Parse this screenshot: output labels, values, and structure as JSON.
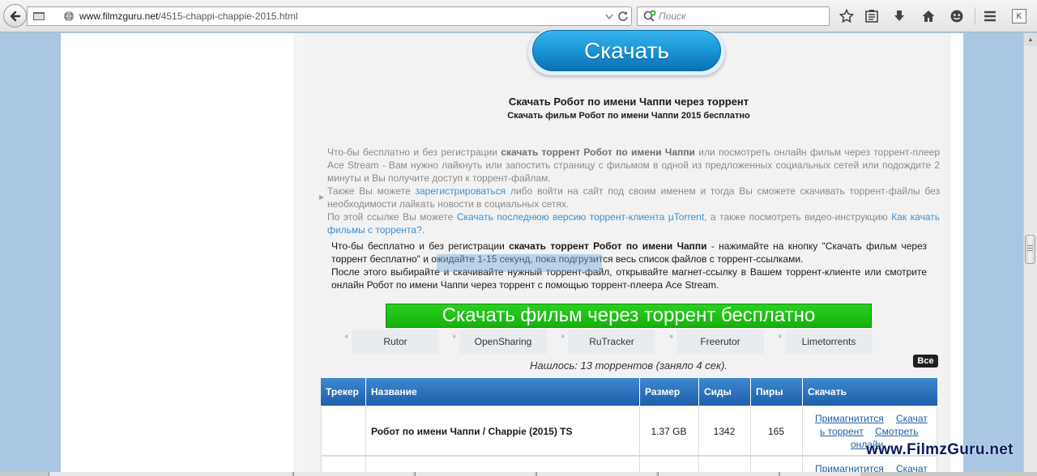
{
  "browser": {
    "url_domain": "www.filmzguru.net",
    "url_path": "/4515-chappi-chappie-2015.html",
    "search_placeholder": "Поиск",
    "icons": [
      "back-arrow-icon",
      "tabs-grid-icon",
      "globe-icon",
      "dropdown-arrow-icon",
      "reload-icon",
      "search-engine-icon",
      "bookmark-star-icon",
      "reading-list-icon",
      "download-icon",
      "home-icon",
      "emoji-icon",
      "menu-icon",
      "extension-k-icon"
    ],
    "extension_label": "K"
  },
  "page": {
    "download_button": "Скачать",
    "heading": "Скачать Робот по имени Чаппи через торрент",
    "subheading": "Скачать фильм Робот по имени Чаппи 2015 бесплатно",
    "info_gray": {
      "p1_pre": "Что-бы бесплатно и без регистрации ",
      "p1_bold": "скачать торрент Робот по имени Чаппи",
      "p1_post": " или посмотреть онлайн фильм через торрент-плеер Ace Stream - Вам нужно лайкнуть или запостить страницу с фильмом в одной из предложенных социальных сетей или подождите 2 минуты и Вы получите доступ к торрент-файлам.",
      "p2_pre": "Также Вы можете ",
      "p2_link": "зарегистрироваться",
      "p2_post": " либо войти на сайт под своим именем и тогда Вы сможете скачивать торрент-файлы без необходимости лайкать новости в социальных сетях.",
      "p3_pre": "По этой ссылке Вы можете ",
      "p3_link1": "Скачать последнюю версию торрент-клиента µTorrent",
      "p3_mid": ", а также посмотреть видео-инструкцию ",
      "p3_link2": "Как качать фильмы с торрента?",
      "p3_end": "."
    },
    "info_black": {
      "p1_pre": "Что-бы бесплатно и без регистрации ",
      "p1_bold": "скачать торрент Робот по имени Чаппи",
      "p1_post": " - нажимайте на кнопку \"Скачать фильм через торрент бесплатно\" и ожидайте 1-15 секунд, пока подгрузится весь список файлов с торрент-ссылками.",
      "p2": "После этого выбирайте и скачивайте нужный торрент-файл, открывайте магнет-ссылку в Вашем торрент-клиенте или смотрите онлайн Робот по имени Чаппи через торрент с помощью торрент-плеера Ace Stream."
    },
    "green_button": "Скачать фильм через торрент бесплатно",
    "tracker_tabs": [
      "Rutor",
      "OpenSharing",
      "RuTracker",
      "Freerutor",
      "Limetorrents"
    ],
    "all_badge": "Все",
    "found_text": "Нашлось: 13 торрентов (заняло 4 сек).",
    "table": {
      "headers": [
        "Трекер",
        "Название",
        "Размер",
        "Сиды",
        "Пиры",
        "Скачать"
      ],
      "rows": [
        {
          "tracker": "",
          "name": "Робот по имени Чаппи / Chappie (2015) TS",
          "size": "1.37 GB",
          "seeds": "1342",
          "peers": "165",
          "link_magnet_1": "Примагнитится",
          "link_magnet_2": "ь торрент",
          "link_dl_1": "Скачат",
          "link_watch_1": "Смотреть",
          "link_watch_2": "онлайн"
        },
        {
          "link_magnet_1": "Примагнитится",
          "link_dl_1": "Скачат"
        }
      ]
    },
    "watermark": "www.FilmzGuru.net"
  }
}
